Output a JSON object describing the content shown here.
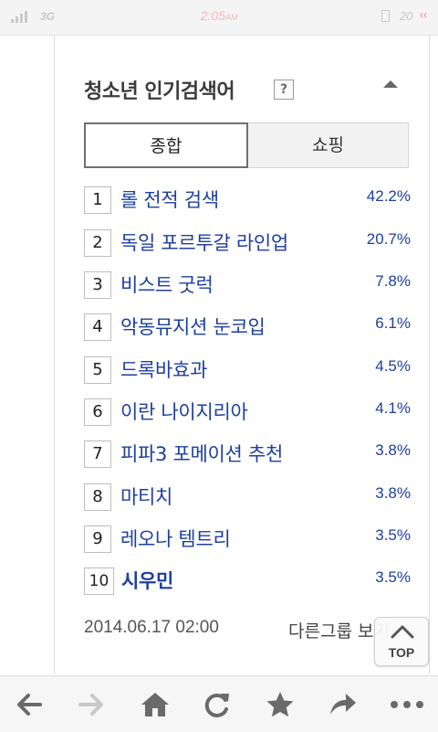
{
  "status_bar": {
    "network": "3G",
    "time": "2:05",
    "ampm": "AM",
    "battery": "20",
    "icons": [
      "signal-icon",
      "sim-icon",
      "chevron-icon"
    ]
  },
  "panel": {
    "title": "청소년 인기검색어",
    "help_label": "?",
    "tabs": [
      {
        "label": "종합",
        "selected": true
      },
      {
        "label": "쇼핑",
        "selected": false
      }
    ],
    "rankings": [
      {
        "rank": "1",
        "term": "롤 전적 검색",
        "percent": "42.2%"
      },
      {
        "rank": "2",
        "term": "독일 포르투갈 라인업",
        "percent": "20.7%"
      },
      {
        "rank": "3",
        "term": "비스트 굿럭",
        "percent": "7.8%"
      },
      {
        "rank": "4",
        "term": "악동뮤지션 눈코입",
        "percent": "6.1%"
      },
      {
        "rank": "5",
        "term": "드록바효과",
        "percent": "4.5%"
      },
      {
        "rank": "6",
        "term": "이란 나이지리아",
        "percent": "4.1%"
      },
      {
        "rank": "7",
        "term": "피파3 포메이션 추천",
        "percent": "3.8%"
      },
      {
        "rank": "8",
        "term": "마티치",
        "percent": "3.8%"
      },
      {
        "rank": "9",
        "term": "레오나 템트리",
        "percent": "3.5%"
      },
      {
        "rank": "10",
        "term": "시우민",
        "percent": "3.5%"
      }
    ],
    "timestamp": "2014.06.17 02:00",
    "other_group_link": "다른그룹 보기"
  },
  "top_button": {
    "label": "TOP"
  },
  "colors": {
    "link_blue": "#1d3f9e",
    "clock_pink": "#f2b7bf"
  },
  "toolbar": {
    "icons": [
      "back-arrow-icon",
      "forward-arrow-icon",
      "home-icon",
      "refresh-icon",
      "bookmark-star-icon",
      "share-arrow-icon",
      "more-dots-icon"
    ]
  }
}
